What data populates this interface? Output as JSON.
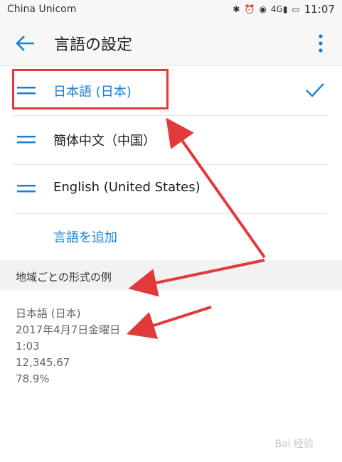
{
  "status_bar": {
    "carrier": "China Unicom",
    "time": "11:07",
    "signal_label": "4G"
  },
  "app_bar": {
    "title": "言語の設定"
  },
  "languages": [
    {
      "label": "日本語 (日本)",
      "selected": true
    },
    {
      "label": "簡体中文（中国）",
      "selected": false
    },
    {
      "label": "English (United States)",
      "selected": false
    }
  ],
  "add_language": "言語を追加",
  "section_header": "地域ごとの形式の例",
  "examples": {
    "language": "日本語 (日本)",
    "date": "2017年4月7日金曜日",
    "time": "1:03",
    "number": "12,345.67",
    "percent": "78.9%"
  },
  "watermark": "Bai 经验"
}
